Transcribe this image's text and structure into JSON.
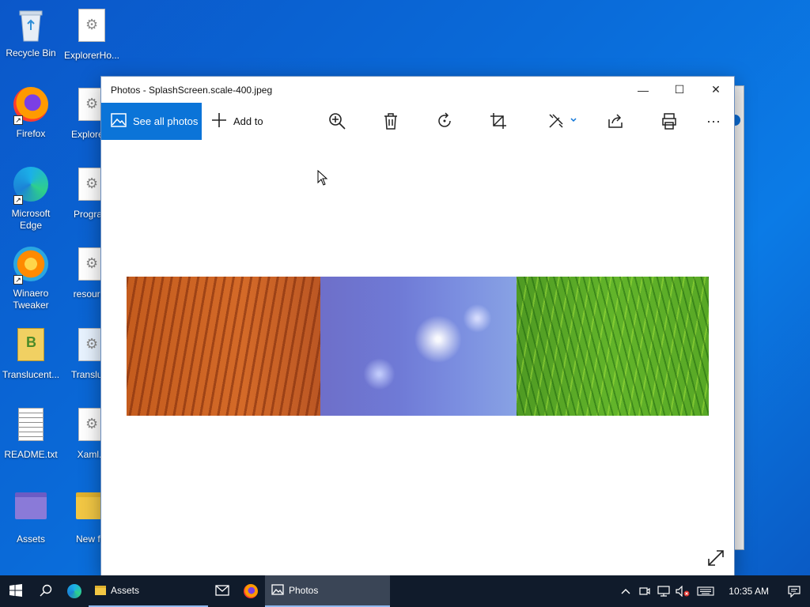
{
  "desktop": {
    "icons": [
      {
        "label": "Recycle Bin"
      },
      {
        "label": "ExplorerHo..."
      },
      {
        "label": "Firefox"
      },
      {
        "label": "ExplorerT"
      },
      {
        "label": "Microsoft Edge"
      },
      {
        "label": "Program"
      },
      {
        "label": "Winaero Tweaker"
      },
      {
        "label": "resource"
      },
      {
        "label": "Translucent..."
      },
      {
        "label": "Transluce"
      },
      {
        "label": "README.txt"
      },
      {
        "label": "Xaml.c"
      },
      {
        "label": "Assets"
      },
      {
        "label": "New fol"
      }
    ]
  },
  "window": {
    "title": "Photos - SplashScreen.scale-400.jpeg",
    "controls": {
      "minimize": "—",
      "maximize": "☐",
      "close": "✕"
    },
    "toolbar": {
      "see_all_photos": "See all photos",
      "add_to": "Add to",
      "tools": [
        "zoom-icon",
        "delete-icon",
        "rotate-icon",
        "crop-icon",
        "edit-icon",
        "share-icon",
        "print-icon",
        "more-icon"
      ],
      "more": "···"
    }
  },
  "taskbar": {
    "tasks": [
      {
        "label": "Assets"
      },
      {
        "label": "Photos"
      }
    ],
    "clock": "10:35 AM",
    "accent": "#0b74d8"
  }
}
